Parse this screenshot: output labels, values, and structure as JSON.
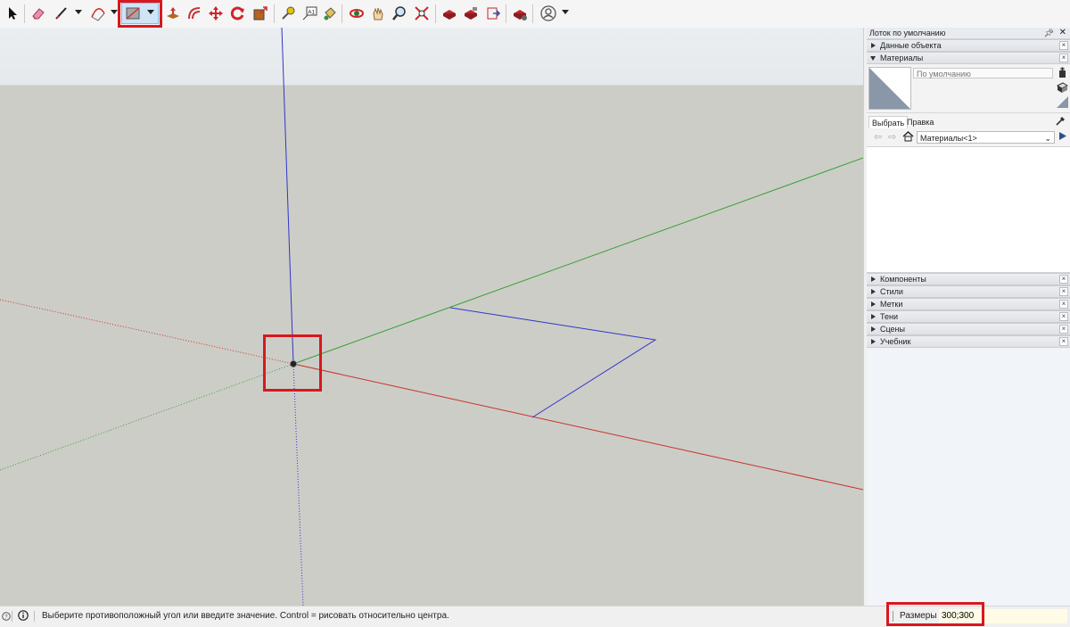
{
  "toolbar": {
    "tools": [
      {
        "name": "select-tool-icon"
      },
      {
        "name": "eraser-tool-icon"
      },
      {
        "name": "line-tool-icon"
      },
      {
        "name": "arc-tool-icon"
      },
      {
        "name": "rectangle-tool-icon"
      },
      {
        "name": "push-pull-tool-icon"
      },
      {
        "name": "offset-tool-icon"
      },
      {
        "name": "move-tool-icon"
      },
      {
        "name": "rotate-tool-icon"
      },
      {
        "name": "scale-tool-icon"
      },
      {
        "name": "tape-measure-tool-icon"
      },
      {
        "name": "text-tool-icon"
      },
      {
        "name": "paint-bucket-tool-icon"
      },
      {
        "name": "orbit-tool-icon"
      },
      {
        "name": "pan-tool-icon"
      },
      {
        "name": "zoom-tool-icon"
      },
      {
        "name": "zoom-extents-tool-icon"
      },
      {
        "name": "warehouse-icon"
      },
      {
        "name": "extension-warehouse-icon"
      },
      {
        "name": "send-to-layout-icon"
      },
      {
        "name": "extension-manager-icon"
      },
      {
        "name": "account-icon"
      }
    ],
    "text_tool_glyph": "A1"
  },
  "colors": {
    "highlight": "#d8181e",
    "axis_red": "#c8312b",
    "axis_green": "#38a038",
    "axis_blue": "#2f35c8",
    "viewport_ground": "#cdcdc7"
  },
  "tray": {
    "title": "Лоток по умолчанию",
    "sections_top": [
      {
        "label": "Данные объекта",
        "expanded": false
      },
      {
        "label": "Материалы",
        "expanded": true
      }
    ],
    "materials": {
      "current_name": "По умолчанию",
      "tabs": [
        "Выбрать",
        "Правка"
      ],
      "library": "Материалы<1>"
    },
    "sections_bottom": [
      {
        "label": "Компоненты"
      },
      {
        "label": "Стили"
      },
      {
        "label": "Метки"
      },
      {
        "label": "Тени"
      },
      {
        "label": "Сцены"
      },
      {
        "label": "Учебник"
      }
    ]
  },
  "status": {
    "message": "Выберите противоположный угол или введите значение. Control = рисовать относительно центра.",
    "vcb_label": "Размеры",
    "vcb_value": "300;300"
  }
}
